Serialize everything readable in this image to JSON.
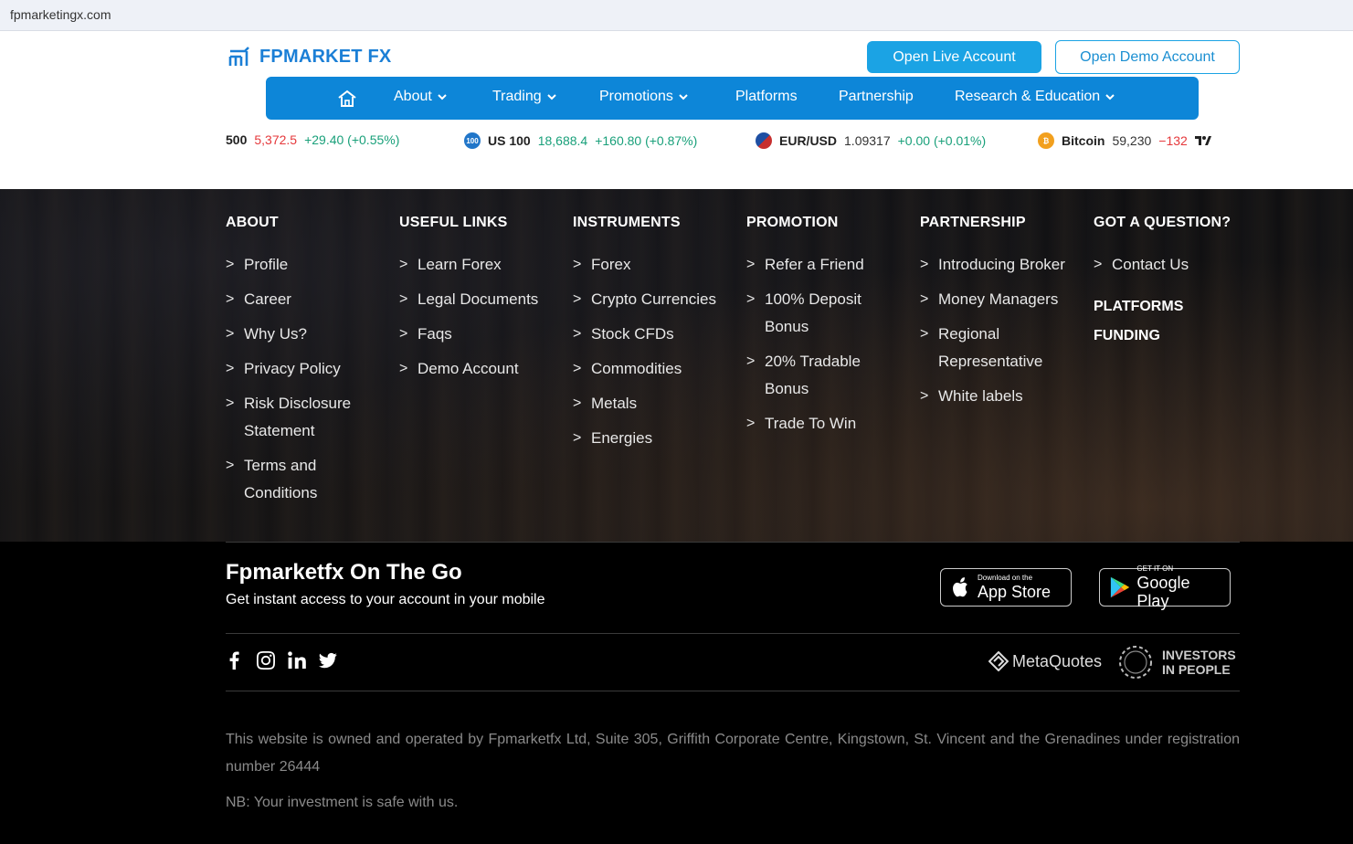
{
  "browser": {
    "url": "fpmarketingx.com"
  },
  "header": {
    "logo_text": "FPMARKET FX",
    "open_live": "Open Live Account",
    "open_demo": "Open Demo Account"
  },
  "nav": {
    "items": [
      {
        "label": "About",
        "dropdown": true
      },
      {
        "label": "Trading",
        "dropdown": true
      },
      {
        "label": "Promotions",
        "dropdown": true
      },
      {
        "label": "Platforms",
        "dropdown": false
      },
      {
        "label": "Partnership",
        "dropdown": false
      },
      {
        "label": "Research & Education",
        "dropdown": true
      }
    ]
  },
  "ticker": [
    {
      "symbol": "500",
      "price": "5,372.5",
      "change": "+29.40 (+0.55%)"
    },
    {
      "symbol": "US 100",
      "icon_text": "100",
      "price": "18,688.4",
      "change": "+160.80 (+0.87%)"
    },
    {
      "symbol": "EUR/USD",
      "price": "1.09317",
      "change": "+0.00 (+0.01%)"
    },
    {
      "symbol": "Bitcoin",
      "price": "59,230",
      "change": "−132"
    }
  ],
  "footer": {
    "columns": [
      {
        "title": "ABOUT",
        "items": [
          "Profile",
          "Career",
          "Why Us?",
          "Privacy Policy",
          "Risk Disclosure Statement",
          "Terms and Conditions"
        ]
      },
      {
        "title": "USEFUL LINKS",
        "items": [
          "Learn Forex",
          "Legal Documents",
          "Faqs",
          "Demo Account"
        ]
      },
      {
        "title": "INSTRUMENTS",
        "items": [
          "Forex",
          "Crypto Currencies",
          "Stock CFDs",
          "Commodities",
          "Metals",
          "Energies"
        ]
      },
      {
        "title": "PROMOTION",
        "items": [
          "Refer a Friend",
          "100% Deposit Bonus",
          "20% Tradable Bonus",
          "Trade To Win"
        ]
      },
      {
        "title": "PARTNERSHIP",
        "items": [
          "Introducing Broker",
          "Money Managers",
          "Regional Representative",
          "White labels"
        ]
      },
      {
        "title": "GOT A QUESTION?",
        "items": [
          "Contact Us"
        ],
        "extra": [
          "PLATFORMS",
          "FUNDING"
        ]
      }
    ],
    "on_the_go_title": "Fpmarketfx On The Go",
    "on_the_go_sub": "Get instant access to your account in your mobile",
    "app_store_small": "Download on the",
    "app_store_big": "App Store",
    "google_small": "GET IT ON",
    "google_big": "Google Play",
    "metaquotes": "MetaQuotes",
    "iip_line1": "INVESTORS",
    "iip_line2": "IN PEOPLE",
    "legal": "This website is owned and operated by Fpmarketfx Ltd, Suite 305, Griffith Corporate Centre, Kingstown, St. Vincent and the Grenadines under registration number 26444",
    "nb": "NB: Your investment is safe with us."
  },
  "colors": {
    "brand": "#0d86d8",
    "accent": "#1ba3e4",
    "up": "#19a07a",
    "down": "#e5383b"
  }
}
